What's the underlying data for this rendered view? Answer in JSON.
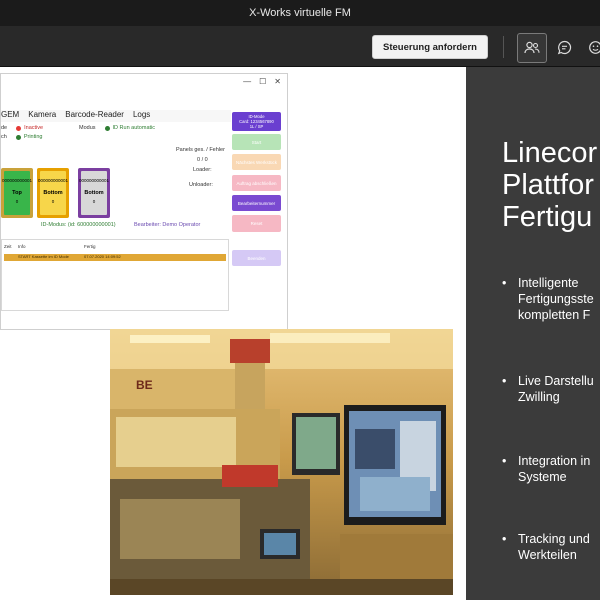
{
  "window": {
    "title": "X-Works virtuelle FM"
  },
  "toolbar": {
    "request_control_label": "Steuerung anfordern",
    "icons": [
      "people-icon",
      "chat-icon",
      "reactions-icon"
    ]
  },
  "slide": {
    "title_lines": [
      "Linecor",
      "Plattfor",
      "Fertigu"
    ],
    "bullets": [
      {
        "lines": [
          "Intelligente",
          "Fertigungsste",
          "kompletten F"
        ]
      },
      {
        "lines": [
          "Live Darstellu",
          "Zwilling"
        ]
      },
      {
        "lines": [
          "Integration in",
          "Systeme"
        ]
      },
      {
        "lines": [
          "Tracking und",
          "Werkteilen"
        ]
      }
    ],
    "bullet_char": "•"
  },
  "app": {
    "menu": [
      "GEM",
      "Kamera",
      "Barcode-Reader",
      "Logs"
    ],
    "status": {
      "row1_left_prefix": "de",
      "row1_left_value": "Inactive",
      "row1_mid_label": "Modus",
      "row1_mid_value": "ID Run automatic",
      "row2_left_prefix": "ch",
      "row2_left_value": "Printing"
    },
    "panels_label": "Panels ges. / Fehler",
    "panels_value": "0 / 0",
    "loader_label": "Loader:",
    "unloader_label": "Unloader:",
    "cards": [
      {
        "id": "000000000001",
        "label": "Top",
        "count": "0",
        "extra": "1",
        "fill": "#39b54a",
        "border": "#c9a23a"
      },
      {
        "id": "000000000001",
        "label": "Bottom",
        "count": "0",
        "extra": "1",
        "fill": "#f7d64a",
        "border": "#e6a000"
      },
      {
        "id": "000000000001",
        "label": "Bottom",
        "count": "0",
        "extra": "1",
        "fill": "#d8d8d8",
        "border": "#7b3fa0"
      }
    ],
    "id_mode": "ID-Modus: (id: 600000000001)",
    "operator": "Bearbeiter: Demo Operator",
    "id_card": {
      "line1": "ID-Mode",
      "line2": "Card: 1234567890",
      "line3": "1L / SP"
    },
    "side_buttons": [
      {
        "label": "Start",
        "color": "#b7e4b7"
      },
      {
        "label": "Nächstes Werkstück",
        "color": "#f9d8b4"
      },
      {
        "label": "Auftrag abschließen",
        "color": "#f6b8c4"
      },
      {
        "label": "Bearbeiternummer",
        "color": "#7a4ad1"
      },
      {
        "label": "Reset",
        "color": "#f6b8c4"
      },
      {
        "label": "Beenden",
        "color": "#d5c9f5"
      }
    ],
    "log": {
      "headers": [
        "Zeit",
        "Info",
        "Fertig"
      ],
      "rows": [
        {
          "time": "",
          "info": "START Kassette im ID Mode",
          "done": "07.07.2020 14:09:52"
        }
      ]
    }
  }
}
